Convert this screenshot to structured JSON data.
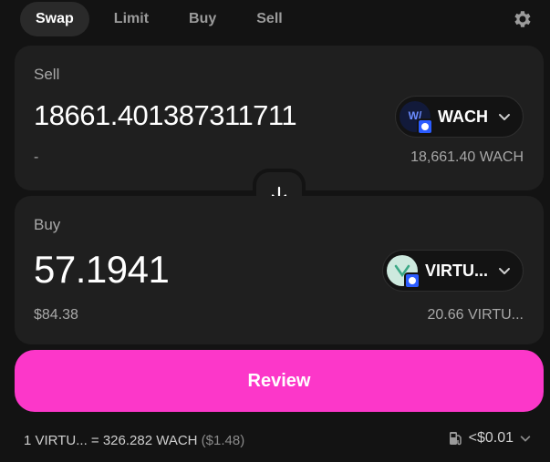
{
  "tabs": [
    {
      "label": "Swap",
      "active": true
    },
    {
      "label": "Limit",
      "active": false
    },
    {
      "label": "Buy",
      "active": false
    },
    {
      "label": "Sell",
      "active": false
    }
  ],
  "settings_icon": "gear-icon",
  "sell": {
    "label": "Sell",
    "amount": "18661.401387311711",
    "usd_value": "-",
    "balance": "18,661.40 WACH",
    "token": {
      "symbol": "WACH",
      "logo_text": "W/",
      "icon": "wach-token-logo"
    }
  },
  "switch_icon": "arrow-down-icon",
  "buy": {
    "label": "Buy",
    "amount": "57.1941",
    "usd_value": "$84.38",
    "balance": "20.66 VIRTU...",
    "token": {
      "symbol": "VIRTU...",
      "icon": "virtu-token-logo"
    }
  },
  "review_label": "Review",
  "footer": {
    "rate": "1 VIRTU... = 326.282 WACH",
    "rate_usd": "($1.48)",
    "gas_fee": "<$0.01",
    "gas_icon": "fuel-pump-icon"
  },
  "colors": {
    "accent": "#fc37c9",
    "background": "#131313",
    "panel": "#1f1f1f",
    "muted_text": "#a8a8a8"
  }
}
